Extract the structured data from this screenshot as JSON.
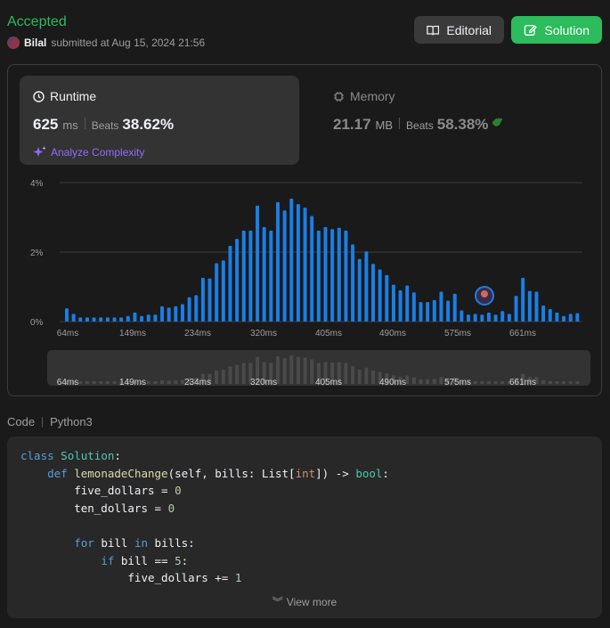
{
  "header": {
    "status": "Accepted",
    "username": "Bilal",
    "submitted_text": "submitted at Aug 15, 2024 21:56",
    "editorial_label": "Editorial",
    "solution_label": "Solution"
  },
  "runtime": {
    "label": "Runtime",
    "value": "625",
    "unit": "ms",
    "beats_label": "Beats",
    "beats": "38.62%",
    "analyze_label": "Analyze Complexity"
  },
  "memory": {
    "label": "Memory",
    "value": "21.17",
    "unit": "MB",
    "beats_label": "Beats",
    "beats": "58.38%"
  },
  "chart_data": {
    "type": "bar",
    "ylim": [
      0,
      4
    ],
    "yticks": [
      "4%",
      "2%",
      "0%"
    ],
    "xticks": [
      "64ms",
      "149ms",
      "234ms",
      "320ms",
      "405ms",
      "490ms",
      "575ms",
      "661ms"
    ],
    "values": [
      0.38,
      0.22,
      0.12,
      0.12,
      0.12,
      0.12,
      0.12,
      0.12,
      0.12,
      0.16,
      0.26,
      0.16,
      0.2,
      0.2,
      0.44,
      0.4,
      0.44,
      0.5,
      0.7,
      0.76,
      1.26,
      1.24,
      1.68,
      1.76,
      2.18,
      2.38,
      2.62,
      2.62,
      3.34,
      2.72,
      2.62,
      3.44,
      3.2,
      3.54,
      3.38,
      3.28,
      3.04,
      2.62,
      2.72,
      2.66,
      2.7,
      2.62,
      2.22,
      1.8,
      2.02,
      1.66,
      1.5,
      1.34,
      1.06,
      0.9,
      1.04,
      0.84,
      0.56,
      0.56,
      0.62,
      0.86,
      0.6,
      0.8,
      0.32,
      0.2,
      0.22,
      0.2,
      0.26,
      0.2,
      0.3,
      0.22,
      0.74,
      1.26,
      0.88,
      0.86,
      0.46,
      0.36,
      0.26,
      0.16,
      0.22,
      0.24
    ],
    "bar_color": "#1a7ee6",
    "highlight_xtick": "575ms"
  },
  "code": {
    "tab_label": "Code",
    "language": "Python3",
    "view_more": "View more"
  }
}
